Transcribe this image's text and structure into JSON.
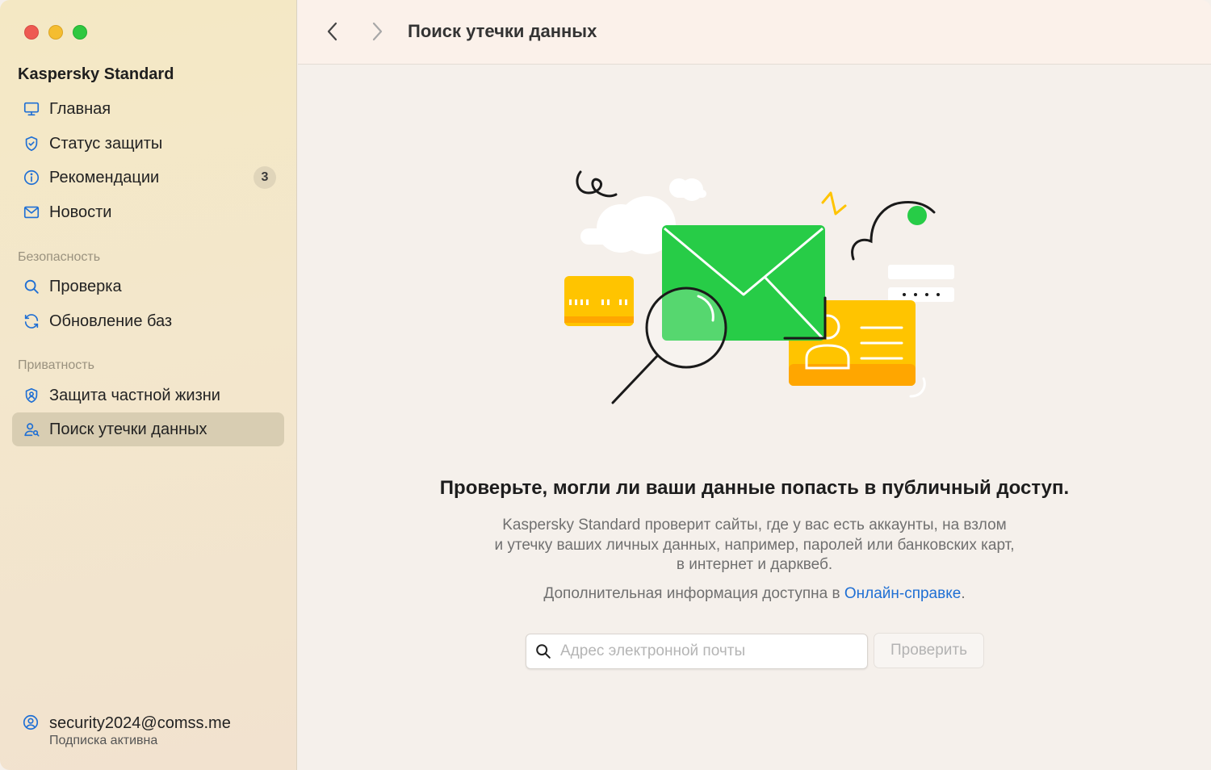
{
  "app": {
    "title": "Kaspersky Standard"
  },
  "sidebar": {
    "main_items": [
      {
        "label": "Главная",
        "icon": "monitor-icon"
      },
      {
        "label": "Статус защиты",
        "icon": "shield-check-icon"
      },
      {
        "label": "Рекомендации",
        "icon": "info-icon",
        "badge": "3"
      },
      {
        "label": "Новости",
        "icon": "mail-icon"
      }
    ],
    "security_section": "Безопасность",
    "security_items": [
      {
        "label": "Проверка",
        "icon": "search-icon"
      },
      {
        "label": "Обновление баз",
        "icon": "refresh-icon"
      }
    ],
    "privacy_section": "Приватность",
    "privacy_items": [
      {
        "label": "Защита частной жизни",
        "icon": "shield-user-icon"
      },
      {
        "label": "Поиск утечки данных",
        "icon": "user-search-icon",
        "active": true
      }
    ],
    "account": {
      "email": "security2024@comss.me",
      "status": "Подписка активна"
    }
  },
  "topbar": {
    "title": "Поиск утечки данных"
  },
  "content": {
    "headline": "Проверьте, могли ли ваши данные попасть в публичный доступ.",
    "description_line1": "Kaspersky Standard проверит сайты, где у вас есть аккаунты, на взлом",
    "description_line2": "и утечку ваших личных данных, например, паролей или банковских карт,",
    "description_line3": "в интернет и дарквеб.",
    "more_prefix": "Дополнительная информация доступна в ",
    "more_link": "Онлайн-справке",
    "more_suffix": ".",
    "search": {
      "placeholder": "Адрес электронной почты",
      "value": ""
    },
    "check_button": "Проверить"
  },
  "colors": {
    "accent_link": "#1f6fd4",
    "envelope_green": "#27cc47",
    "card_yellow": "#ffc400",
    "sidebar_active": "#d8cdb2"
  }
}
